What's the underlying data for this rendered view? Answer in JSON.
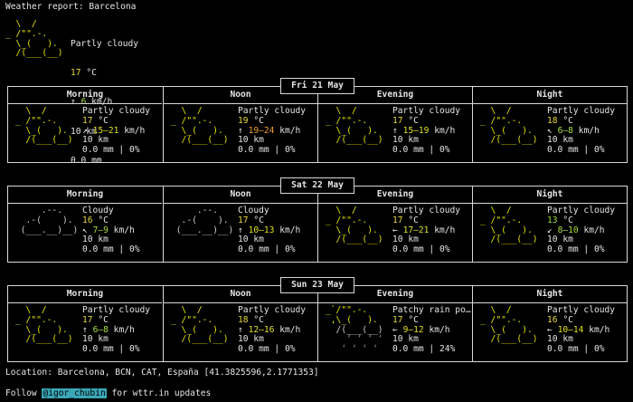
{
  "title": "Weather report: Barcelona",
  "current": {
    "art": [
      "  \\  /",
      "_ /\"\".-.",
      "  \\_(   ).",
      "  /(___(__)"
    ],
    "lines": [
      "Partly cloudy",
      "17 °C",
      "↑ 6 km/h",
      "10 km",
      "0.0 mm"
    ],
    "temp": "17",
    "wind_speed": "6"
  },
  "days": [
    {
      "date": "Fri 21 May",
      "periods": [
        {
          "name": "Morning",
          "art": "pc",
          "cond": "Partly cloudy",
          "temp": "17",
          "temp_unit": " °C",
          "wind_dir": "↗",
          "wind": "15–21",
          "wind_unit": " km/h",
          "vis": "10 km",
          "precip": "0.0 mm | 0%"
        },
        {
          "name": "Noon",
          "art": "pc",
          "cond": "Partly cloudy",
          "temp": "19",
          "temp_unit": " °C",
          "wind_dir": "↑",
          "wind": "19–24",
          "wind_unit": " km/h",
          "vis": "10 km",
          "precip": "0.0 mm | 0%"
        },
        {
          "name": "Evening",
          "art": "pc",
          "cond": "Partly cloudy",
          "temp": "17",
          "temp_unit": " °C",
          "wind_dir": "↑",
          "wind": "15–19",
          "wind_unit": " km/h",
          "vis": "10 km",
          "precip": "0.0 mm | 0%"
        },
        {
          "name": "Night",
          "art": "pc",
          "cond": "Partly cloudy",
          "temp": "18",
          "temp_unit": " °C",
          "wind_dir": "↖",
          "wind": "6–8",
          "wind_unit": " km/h",
          "vis": "10 km",
          "precip": "0.0 mm | 0%"
        }
      ]
    },
    {
      "date": "Sat 22 May",
      "periods": [
        {
          "name": "Morning",
          "art": "cloudy",
          "cond": "Cloudy",
          "temp": "16",
          "temp_unit": " °C",
          "wind_dir": "↖",
          "wind": "7–9",
          "wind_unit": " km/h",
          "vis": "10 km",
          "precip": "0.0 mm | 0%"
        },
        {
          "name": "Noon",
          "art": "cloudy",
          "cond": "Cloudy",
          "temp": "17",
          "temp_unit": " °C",
          "wind_dir": "↑",
          "wind": "10–13",
          "wind_unit": " km/h",
          "vis": "10 km",
          "precip": "0.0 mm | 0%"
        },
        {
          "name": "Evening",
          "art": "pc",
          "cond": "Partly cloudy",
          "temp": "17",
          "temp_unit": " °C",
          "wind_dir": "←",
          "wind": "17–21",
          "wind_unit": " km/h",
          "vis": "10 km",
          "precip": "0.0 mm | 0%"
        },
        {
          "name": "Night",
          "art": "pc",
          "cond": "Partly cloudy",
          "temp": "13",
          "temp_unit": " °C",
          "wind_dir": "↙",
          "wind": "8–10",
          "wind_unit": " km/h",
          "vis": "10 km",
          "precip": "0.0 mm | 0%"
        }
      ]
    },
    {
      "date": "Sun 23 May",
      "periods": [
        {
          "name": "Morning",
          "art": "pc",
          "cond": "Partly cloudy",
          "temp": "17",
          "temp_unit": " °C",
          "wind_dir": "↑",
          "wind": "6–8",
          "wind_unit": " km/h",
          "vis": "10 km",
          "precip": "0.0 mm | 0%"
        },
        {
          "name": "Noon",
          "art": "pc",
          "cond": "Partly cloudy",
          "temp": "18",
          "temp_unit": " °C",
          "wind_dir": "↑",
          "wind": "12–16",
          "wind_unit": " km/h",
          "vis": "10 km",
          "precip": "0.0 mm | 0%"
        },
        {
          "name": "Evening",
          "art": "rain",
          "cond": "Patchy rain po…",
          "temp": "17",
          "temp_unit": " °C",
          "wind_dir": "←",
          "wind": "9–12",
          "wind_unit": " km/h",
          "vis": "10 km",
          "precip": "0.0 mm | 24%"
        },
        {
          "name": "Night",
          "art": "pc",
          "cond": "Partly cloudy",
          "temp": "16",
          "temp_unit": " °C",
          "wind_dir": "←",
          "wind": "10–14",
          "wind_unit": " km/h",
          "vis": "10 km",
          "precip": "0.0 mm | 0%"
        }
      ]
    }
  ],
  "art_sets": {
    "pc": [
      "  \\  /",
      "_ /\"\".-.",
      "  \\_(   ).",
      "  /(___(__)"
    ],
    "cloudy": [
      "",
      "     .--.",
      "  .-(    ).",
      " (___.__)__)"
    ],
    "rain": [
      "_`/\"\".-.",
      " ,\\_(   ).",
      "  /(___(__)",
      "    ‘ ‘ ‘ ‘",
      "   ‘ ‘ ‘ ‘"
    ]
  },
  "location": "Location: Barcelona, BCN, CAT, España [41.3825596,2.1771353]",
  "follow_prefix": "Follow ",
  "follow_handle": "@igor_chubin",
  "follow_suffix": " for wttr.in updates"
}
